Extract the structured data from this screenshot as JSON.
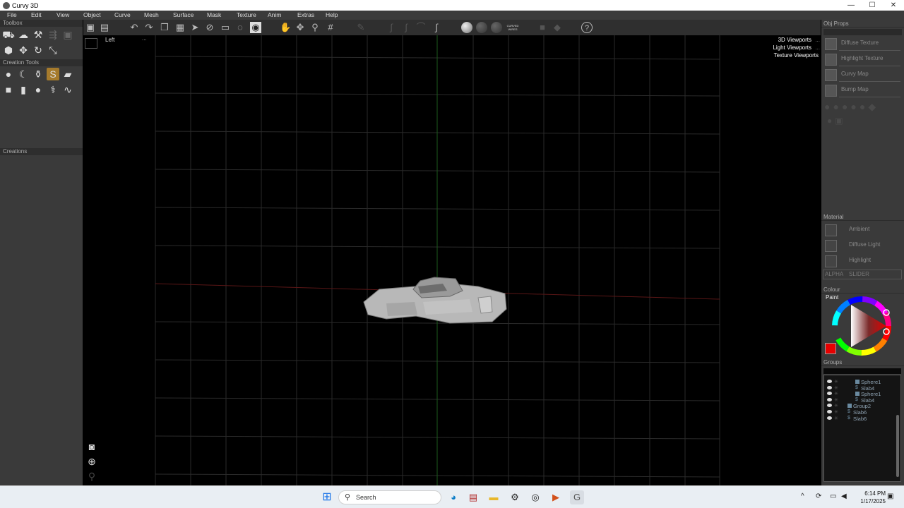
{
  "window": {
    "title": "Curvy 3D",
    "minimize": "—",
    "maximize": "☐",
    "close": "✕"
  },
  "menubar": [
    "File",
    "Edit",
    "View",
    "Object",
    "Curve",
    "Mesh",
    "Surface",
    "Mask",
    "Texture",
    "Anim",
    "Extras",
    "Help"
  ],
  "toolbox": {
    "title": "Toolbox",
    "creation_tools_title": "Creation Tools",
    "creations_title": "Creations"
  },
  "viewport": {
    "label": "Left",
    "dots": "...",
    "links": [
      "3D Viewports",
      "Light Viewports",
      "Texture Viewports"
    ],
    "link_dots": [
      "...",
      "...",
      ""
    ]
  },
  "toolbar": {
    "curved_wires_label": "CURVED WIRES"
  },
  "obj_props": {
    "title": "Obj Props",
    "textures": [
      "Diffuse Texture",
      "Highlight Texture",
      "Curvy Map",
      "Bump Map"
    ]
  },
  "material": {
    "title": "Material",
    "items": [
      "Ambient",
      "Diffuse Light",
      "Highlight"
    ],
    "alpha_label": "ALPHA",
    "slider_label": "SLIDER"
  },
  "colour": {
    "title": "Colour",
    "mode": "Paint",
    "current_color": "#e60000"
  },
  "groups": {
    "title": "Groups",
    "items": [
      "Sphere1",
      "Slab4",
      "Sphere1",
      "Slab4",
      "Group2",
      "Slab6",
      "Slab6"
    ]
  },
  "taskbar": {
    "search_placeholder": "Search",
    "time": "6:14 PM",
    "date": "1/17/2025"
  }
}
